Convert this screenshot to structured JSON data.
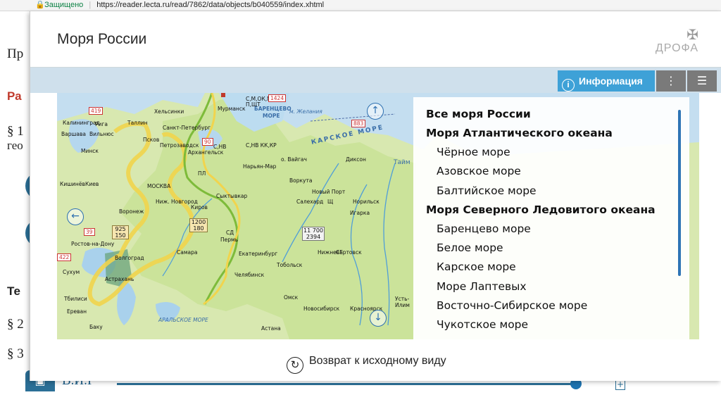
{
  "browser": {
    "secure_label": "Защищено",
    "url": "https://reader.lecta.ru/read/7862/data/objects/b040559/index.xhtml"
  },
  "bg": {
    "line1": "Пр",
    "red_heading": "Ра",
    "sect1": "§ 1",
    "sect1b": "гео",
    "bold_heading": "Те",
    "sect2": "§ 2",
    "sect3": "§ 3",
    "author": "В.И.I"
  },
  "modal": {
    "title": "Моря России",
    "logo_text": "ДРОФА",
    "info_label": "Информация",
    "reset_label": "Возврат к исходному виду"
  },
  "map_labels": {
    "city_moscow": "МОСКВА",
    "city_spb": "Санкт-Петербург",
    "city_helsinki": "Хельсинки",
    "city_tallinn": "Таллин",
    "city_riga": "Рига",
    "city_kaliningrad": "Калининград",
    "city_warsaw": "Варшава",
    "city_minsk": "Минск",
    "city_vilnius": "Вильнюс",
    "city_kiev": "Киев",
    "city_kishinev": "Кишинёв",
    "city_pskov": "Псков",
    "city_petrozavodsk": "Петрозаводск",
    "city_arkhangelsk": "Архангельск",
    "city_murmansk": "Мурманск",
    "city_voronezh": "Воронеж",
    "city_rostov": "Ростов-на-Дону",
    "city_volgograd": "Волгоград",
    "city_astrakhan": "Астрахань",
    "city_samara": "Самара",
    "city_kirov": "Киров",
    "city_syktyvkar": "Сыктывкар",
    "city_perm": "Пермь",
    "city_ekb": "Екатеринбург",
    "city_chelyabinsk": "Челябинск",
    "city_tobolsk": "Тобольск",
    "city_omsk": "Омск",
    "city_novosibirsk": "Новосибирск",
    "city_krasnoyarsk": "Красноярск",
    "city_astana": "Астана",
    "city_baku": "Баку",
    "city_tbilisi": "Тбилиси",
    "city_erevan": "Ереван",
    "city_sukhum": "Сухум",
    "city_salekhard": "Салехард",
    "city_vorkuta": "Воркута",
    "city_naryanmar": "Нарьян-Мар",
    "city_novyport": "Новый Порт",
    "city_igarka": "Игарка",
    "city_norilsk": "Норильск",
    "city_dikson": "Диксон",
    "city_nizhnevartovsk": "Нижневартовск",
    "city_novgorod": "Ниж. Новгород",
    "city_ustilim": "Усть-Илим",
    "sea_barents": "БАРЕНЦЕВО",
    "sea_barents2": "МОРЕ",
    "sea_kara": "КАРСКОЕ МОРЕ",
    "sea_aral": "АРАЛЬСКОЕ МОРЕ",
    "island_fjl": "м. Желания",
    "val_1424": "1424",
    "val_419": "419",
    "val_883": "883",
    "val_90": "90",
    "val_39": "39",
    "val_422": "422",
    "box1_a": "925",
    "box1_b": "150",
    "box2_a": "1200",
    "box2_b": "180",
    "box3_a": "11 700",
    "box3_b": "2394",
    "res_somokm": "С,М,ОК,М",
    "res_pshst": "П,ЩТ",
    "res_snv": "С,НВ",
    "res_snvkp": "С,НВ КК,КР",
    "res_vaygach": "о. Вайгач",
    "res_shch": "Щ",
    "res_sg": "СГ",
    "res_sd": "СД",
    "res_pl": "ПЛ",
    "sea_tai": "Тайм"
  },
  "list": {
    "all": "Все моря России",
    "groups": [
      {
        "title": "Моря Атлантического океана",
        "items": [
          "Чёрное море",
          "Азовское море",
          "Балтийское море"
        ]
      },
      {
        "title": "Моря Северного Ледовитого океана",
        "items": [
          "Баренцево море",
          "Белое море",
          "Карское море",
          "Море Лаптевых",
          "Восточно-Сибирское море",
          "Чукотское море"
        ]
      }
    ]
  },
  "colors": {
    "toolbar_strip": "#cfe0ec",
    "info_button": "#3ea1d7",
    "tool_button": "#7a7a7a",
    "land": "#cfe3a0",
    "sea": "#bfdcef",
    "highlight_yellow": "#f1d44d",
    "border_green": "#7dbb3a",
    "scrollbar": "#2e74b5"
  },
  "icons": {
    "lock": "lock-icon",
    "info": "info-icon",
    "tree": "tree-icon",
    "list": "list-icon",
    "reset": "reset-icon",
    "nav_up": "arrow-up-icon",
    "nav_left": "arrow-left-icon",
    "nav_down": "arrow-down-icon"
  }
}
